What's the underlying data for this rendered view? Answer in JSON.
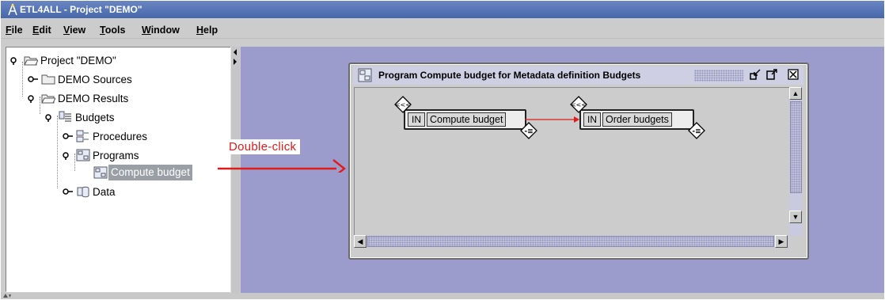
{
  "window": {
    "title": "ETL4ALL - Project \"DEMO\""
  },
  "menu": [
    "File",
    "Edit",
    "View",
    "Tools",
    "Window",
    "Help"
  ],
  "tree": {
    "project": "Project \"DEMO\"",
    "sources": "DEMO Sources",
    "results": "DEMO Results",
    "budgets": "Budgets",
    "procedures": "Procedures",
    "programs": "Programs",
    "compute_budget": "Compute budget",
    "data": "Data"
  },
  "annotation": {
    "text": "Double-click",
    "color": "#e01b1b"
  },
  "internal_frame": {
    "title": "Program Compute budget for Metadata definition Budgets",
    "blocks": [
      {
        "in": "IN",
        "name": "Compute budget",
        "in_port": "<<<",
        "out_port": "-≡"
      },
      {
        "in": "IN",
        "name": "Order budgets",
        "in_port": "<<<",
        "out_port": "-≡"
      }
    ]
  },
  "colors": {
    "desktop": "#9c9ccc",
    "titlebar": "#4767aa",
    "selection": "#9a9fa6"
  }
}
